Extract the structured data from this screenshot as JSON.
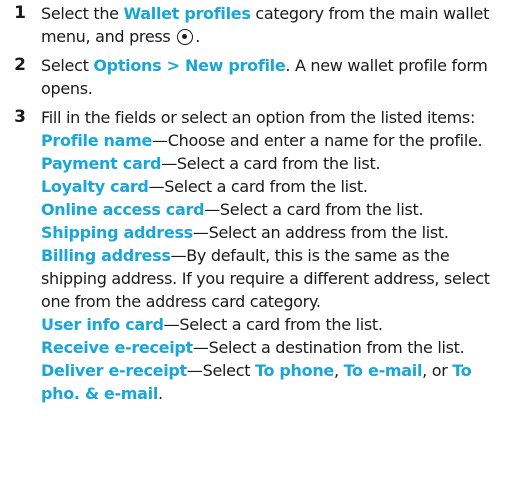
{
  "steps": [
    {
      "num": "1",
      "t1": "Select the ",
      "k1": "Wallet profiles",
      "t2": " category from the main wallet menu, and press ",
      "t3": "."
    },
    {
      "num": "2",
      "t1": "Select ",
      "k1": "Options > New profile",
      "t2": ". A new wallet profile form opens."
    },
    {
      "num": "3",
      "intro": "Fill in the fields or select an option from the listed items:"
    }
  ],
  "fields": [
    {
      "label": "Profile name",
      "desc": "—Choose and enter a name for the profile."
    },
    {
      "label": "Payment card",
      "desc": "—Select a card from the list."
    },
    {
      "label": "Loyalty card",
      "desc": "—Select a card from the list."
    },
    {
      "label": "Online access card",
      "desc": "—Select a card from the list."
    },
    {
      "label": "Shipping address",
      "desc": "—Select an address from the list."
    },
    {
      "label": "Billing address",
      "desc": "—By default, this is the same as the shipping address. If you require a different address, select one from the address card category."
    },
    {
      "label": "User info card",
      "desc": "—Select a card from the list."
    },
    {
      "label": "Receive e-receipt",
      "desc": "—Select a destination from the list."
    }
  ],
  "deliver": {
    "label": "Deliver e-receipt",
    "t1": "—Select ",
    "o1": "To phone",
    "t2": ", ",
    "o2": "To e-mail",
    "t3": ", or ",
    "o3": "To pho. & e-mail",
    "t4": "."
  },
  "icons": {
    "nav_key": "navigation-key-icon"
  },
  "colors": {
    "keyword": "#1aa6d6",
    "text": "#1a1a1a"
  }
}
